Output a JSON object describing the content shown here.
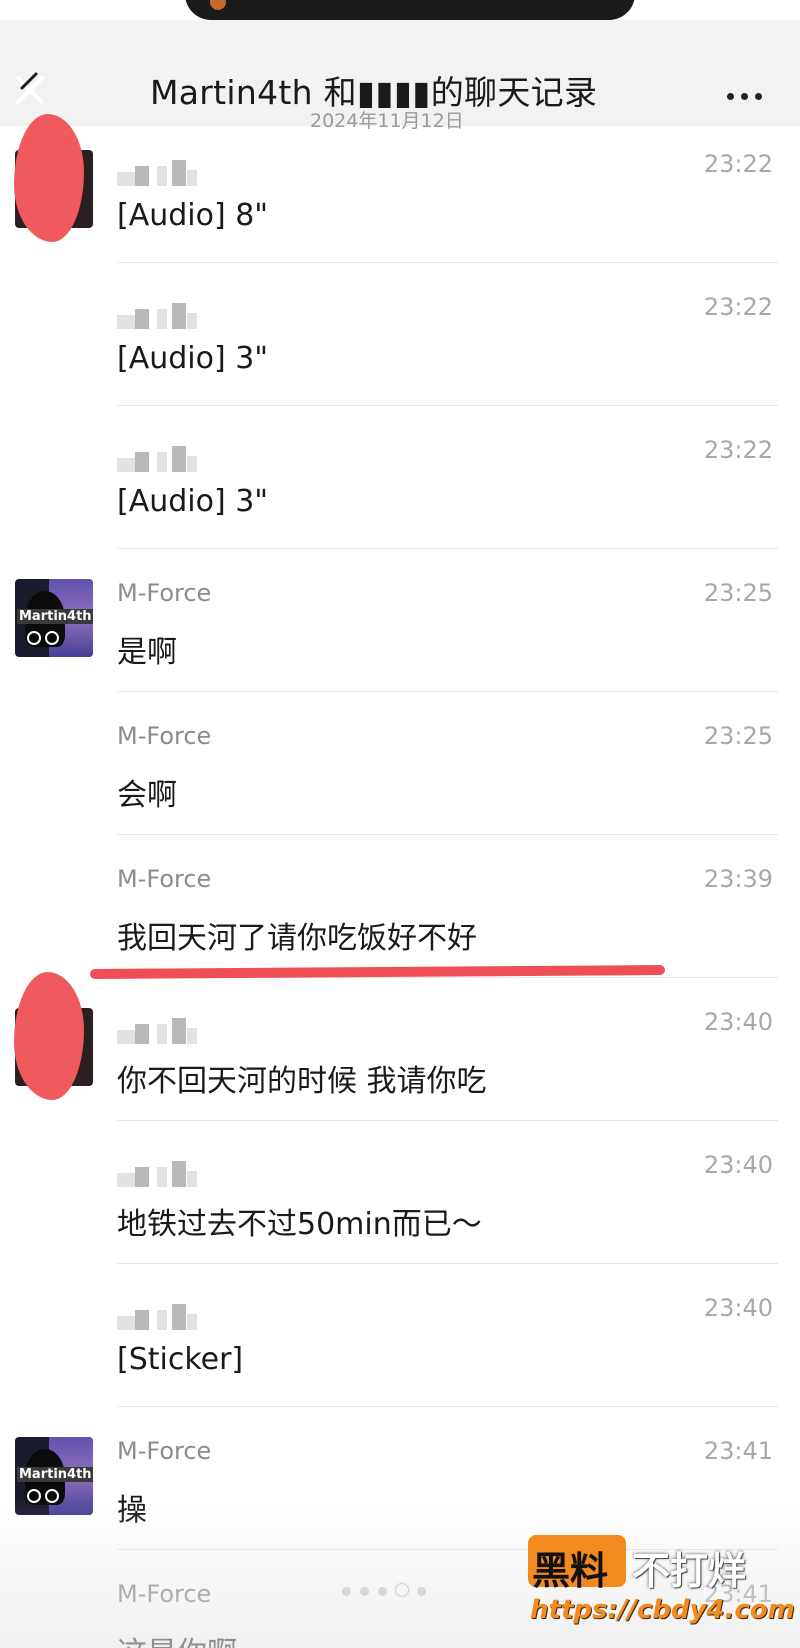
{
  "header": {
    "title": "Martin4th 和▮▮▮▮的聊天记录",
    "subtitle": "2024年11月12日",
    "back_icon": "back-close-icon",
    "more_icon": "more-dots-icon"
  },
  "messages": [
    {
      "sender": "",
      "time": "23:22",
      "text": "[Audio]  8\"",
      "avatar": "redacted"
    },
    {
      "sender": "",
      "time": "23:22",
      "text": "[Audio]  3\"",
      "avatar": ""
    },
    {
      "sender": "",
      "time": "23:22",
      "text": "[Audio]  3\"",
      "avatar": ""
    },
    {
      "sender": "M-Force",
      "time": "23:25",
      "text": "是啊",
      "avatar": "martin4th"
    },
    {
      "sender": "M-Force",
      "time": "23:25",
      "text": "会啊",
      "avatar": ""
    },
    {
      "sender": "M-Force",
      "time": "23:39",
      "text": "我回天河了请你吃饭好不好",
      "avatar": ""
    },
    {
      "sender": "",
      "time": "23:40",
      "text": "你不回天河的时候 我请你吃",
      "avatar": "redacted"
    },
    {
      "sender": "",
      "time": "23:40",
      "text": "地铁过去不过50min而已～",
      "avatar": ""
    },
    {
      "sender": "",
      "time": "23:40",
      "text": "[Sticker]",
      "avatar": ""
    },
    {
      "sender": "M-Force",
      "time": "23:41",
      "text": "操",
      "avatar": "martin4th"
    },
    {
      "sender": "M-Force",
      "time": "23:41",
      "text": "这是你啊",
      "avatar": ""
    }
  ],
  "avatar_label": "Martin4th",
  "watermark": {
    "brand_a": "黑料",
    "brand_b": "不打烊",
    "url": "https://cbdy4.com"
  },
  "pager": {
    "count": 5,
    "active": 4
  },
  "colors": {
    "header_bg": "#f2f2f2",
    "scribble": "#f05a5e",
    "brand": "#f28a1f"
  }
}
